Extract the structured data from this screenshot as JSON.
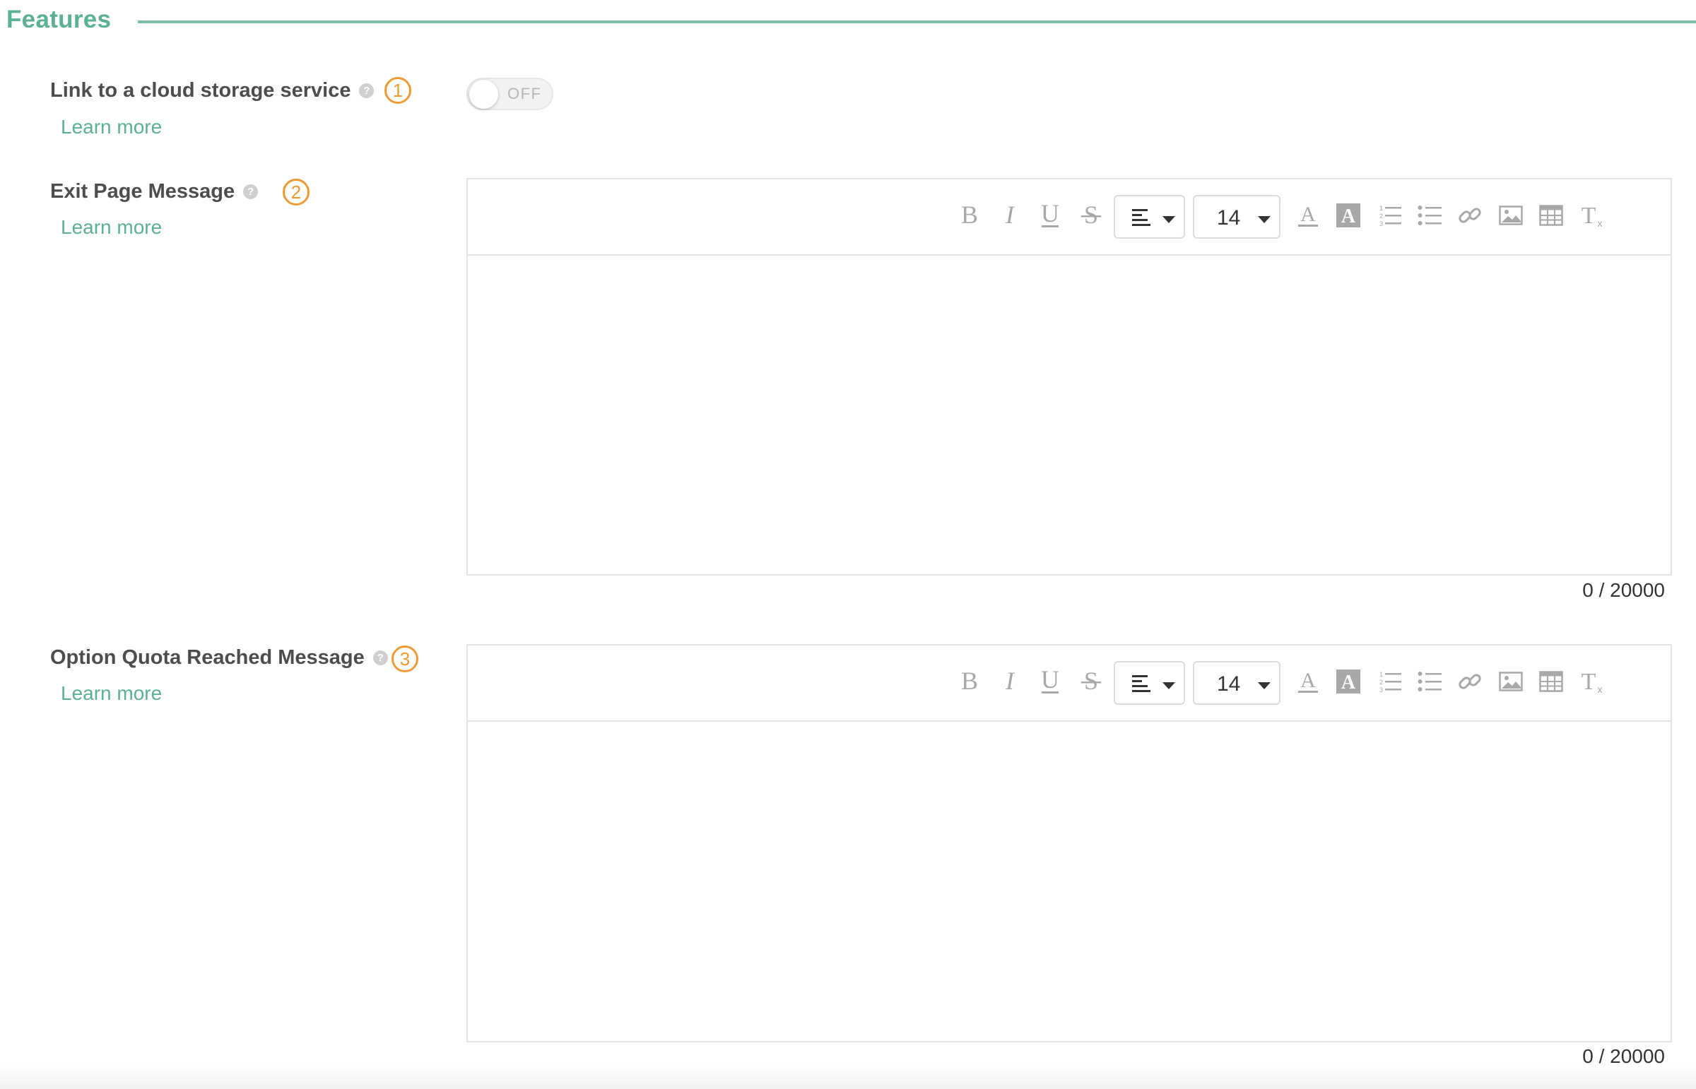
{
  "section": {
    "title": "Features"
  },
  "rows": [
    {
      "label": "Link to a cloud storage service",
      "step": "1",
      "learn_more": "Learn more",
      "toggle_state": "OFF"
    },
    {
      "label": "Exit Page Message",
      "step": "2",
      "learn_more": "Learn more",
      "font_size": "14",
      "char_count": "0 / 20000",
      "content": ""
    },
    {
      "label": "Option Quota Reached Message",
      "step": "3",
      "learn_more": "Learn more",
      "font_size": "14",
      "char_count": "0 / 20000",
      "content": ""
    }
  ],
  "toolbar_icons": [
    "bold-icon",
    "italic-icon",
    "underline-icon",
    "strikethrough-icon",
    "align-left-icon",
    "font-size",
    "font-color-icon",
    "background-color-icon",
    "ordered-list-icon",
    "bullet-list-icon",
    "link-icon",
    "image-icon",
    "table-icon",
    "clear-format-icon"
  ],
  "colors": {
    "accent": "#5cb094",
    "badge": "#ee9a33",
    "label": "#4d4d4d",
    "icon": "#a8a8a8"
  }
}
